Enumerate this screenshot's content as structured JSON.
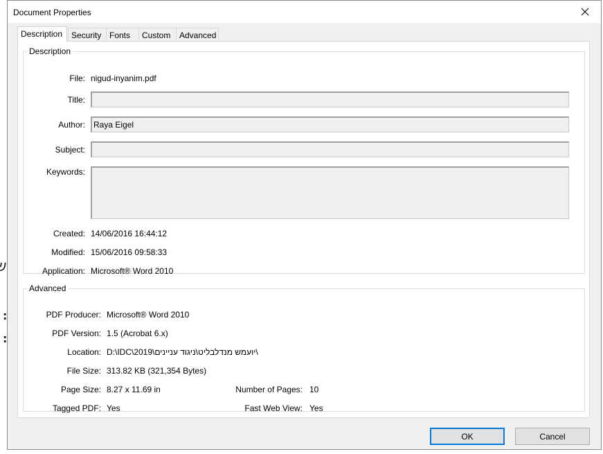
{
  "background": {
    "glyphs": [
      "ש",
      ":",
      ":"
    ]
  },
  "dialog": {
    "title": "Document Properties",
    "close_icon": "close-icon",
    "tabs": [
      {
        "label": "Description",
        "active": true
      },
      {
        "label": "Security"
      },
      {
        "label": "Fonts"
      },
      {
        "label": "Custom"
      },
      {
        "label": "Advanced"
      }
    ],
    "description": {
      "legend": "Description",
      "file_label": "File:",
      "file_value": "nigud-inyanim.pdf",
      "title_label": "Title:",
      "title_value": "",
      "author_label": "Author:",
      "author_value": "Raya Eigel",
      "subject_label": "Subject:",
      "subject_value": "",
      "keywords_label": "Keywords:",
      "keywords_value": "",
      "created_label": "Created:",
      "created_value": "14/06/2016 16:44:12",
      "modified_label": "Modified:",
      "modified_value": "15/06/2016 09:58:33",
      "application_label": "Application:",
      "application_value": "Microsoft® Word 2010"
    },
    "advanced": {
      "legend": "Advanced",
      "producer_label": "PDF Producer:",
      "producer_value": "Microsoft® Word 2010",
      "version_label": "PDF Version:",
      "version_value": "1.5 (Acrobat 6.x)",
      "location_label": "Location:",
      "location_value": "D:\\IDC\\2019\\יועמש מנדלבליט\\ניגוד עניינים\\",
      "filesize_label": "File Size:",
      "filesize_value": "313.82 KB (321,354 Bytes)",
      "pagesize_label": "Page Size:",
      "pagesize_value": "8.27 x 11.69 in",
      "pages_label": "Number of Pages:",
      "pages_value": "10",
      "tagged_label": "Tagged PDF:",
      "tagged_value": "Yes",
      "fastweb_label": "Fast Web View:",
      "fastweb_value": "Yes"
    },
    "buttons": {
      "ok": "OK",
      "cancel": "Cancel"
    }
  }
}
